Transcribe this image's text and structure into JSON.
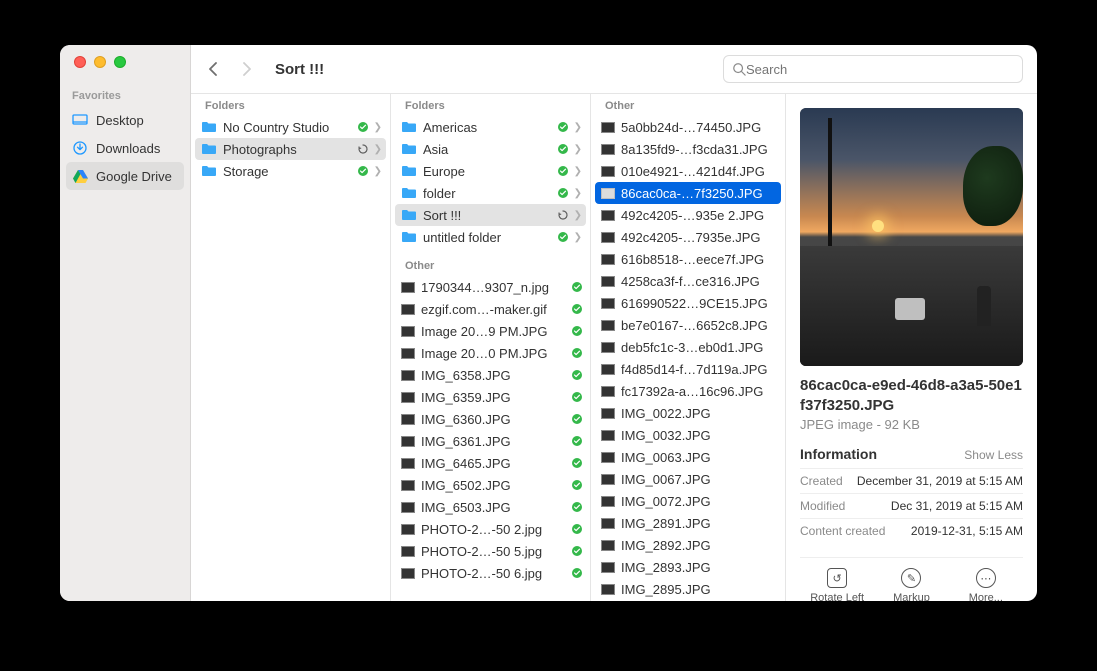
{
  "window_title": "Sort !!!",
  "search": {
    "placeholder": "Search"
  },
  "sidebar": {
    "section": "Favorites",
    "items": [
      {
        "label": "Desktop",
        "icon": "desktop"
      },
      {
        "label": "Downloads",
        "icon": "download"
      },
      {
        "label": "Google Drive",
        "icon": "gdrive",
        "selected": true
      }
    ]
  },
  "col1": {
    "header": "Folders",
    "items": [
      {
        "name": "No Country Studio",
        "status": "synced"
      },
      {
        "name": "Photographs",
        "status": "syncing",
        "selected": true
      },
      {
        "name": "Storage",
        "status": "synced"
      }
    ]
  },
  "col2": {
    "header1": "Folders",
    "folders": [
      {
        "name": "Americas",
        "status": "synced"
      },
      {
        "name": "Asia",
        "status": "synced"
      },
      {
        "name": "Europe",
        "status": "synced"
      },
      {
        "name": "folder",
        "status": "synced"
      },
      {
        "name": "Sort !!!",
        "status": "syncing",
        "selected": true
      },
      {
        "name": "untitled folder",
        "status": "synced"
      }
    ],
    "header2": "Other",
    "others": [
      {
        "name": "1790344…9307_n.jpg",
        "status": "synced"
      },
      {
        "name": "ezgif.com…-maker.gif",
        "status": "synced"
      },
      {
        "name": "Image 20…9 PM.JPG",
        "status": "synced"
      },
      {
        "name": "Image 20…0 PM.JPG",
        "status": "synced"
      },
      {
        "name": "IMG_6358.JPG",
        "status": "synced"
      },
      {
        "name": "IMG_6359.JPG",
        "status": "synced"
      },
      {
        "name": "IMG_6360.JPG",
        "status": "synced"
      },
      {
        "name": "IMG_6361.JPG",
        "status": "synced"
      },
      {
        "name": "IMG_6465.JPG",
        "status": "synced"
      },
      {
        "name": "IMG_6502.JPG",
        "status": "synced"
      },
      {
        "name": "IMG_6503.JPG",
        "status": "synced"
      },
      {
        "name": "PHOTO-2…-50 2.jpg",
        "status": "synced"
      },
      {
        "name": "PHOTO-2…-50 5.jpg",
        "status": "synced"
      },
      {
        "name": "PHOTO-2…-50 6.jpg",
        "status": "synced"
      }
    ]
  },
  "col3": {
    "header": "Other",
    "items": [
      {
        "name": "5a0bb24d-…74450.JPG"
      },
      {
        "name": "8a135fd9-…f3cda31.JPG"
      },
      {
        "name": "010e4921-…421d4f.JPG"
      },
      {
        "name": "86cac0ca-…7f3250.JPG",
        "selected": true
      },
      {
        "name": "492c4205-…935e 2.JPG"
      },
      {
        "name": "492c4205-…7935e.JPG"
      },
      {
        "name": "616b8518-…eece7f.JPG"
      },
      {
        "name": "4258ca3f-f…ce316.JPG"
      },
      {
        "name": "616990522…9CE15.JPG"
      },
      {
        "name": "be7e0167-…6652c8.JPG"
      },
      {
        "name": "deb5fc1c-3…eb0d1.JPG"
      },
      {
        "name": "f4d85d14-f…7d119a.JPG"
      },
      {
        "name": "fc17392a-a…16c96.JPG"
      },
      {
        "name": "IMG_0022.JPG"
      },
      {
        "name": "IMG_0032.JPG"
      },
      {
        "name": "IMG_0063.JPG"
      },
      {
        "name": "IMG_0067.JPG"
      },
      {
        "name": "IMG_0072.JPG"
      },
      {
        "name": "IMG_2891.JPG"
      },
      {
        "name": "IMG_2892.JPG"
      },
      {
        "name": "IMG_2893.JPG"
      },
      {
        "name": "IMG_2895.JPG"
      }
    ]
  },
  "preview": {
    "filename": "86cac0ca-e9ed-46d8-a3a5-50e1f37f3250.JPG",
    "kind": "JPEG image - 92 KB",
    "info_header": "Information",
    "show_less": "Show Less",
    "rows": [
      {
        "k": "Created",
        "v": "December 31, 2019 at 5:15 AM"
      },
      {
        "k": "Modified",
        "v": "Dec 31, 2019 at 5:15 AM"
      },
      {
        "k": "Content created",
        "v": "2019-12-31, 5:15 AM"
      }
    ],
    "actions": {
      "rotate": "Rotate Left",
      "markup": "Markup",
      "more": "More..."
    }
  }
}
